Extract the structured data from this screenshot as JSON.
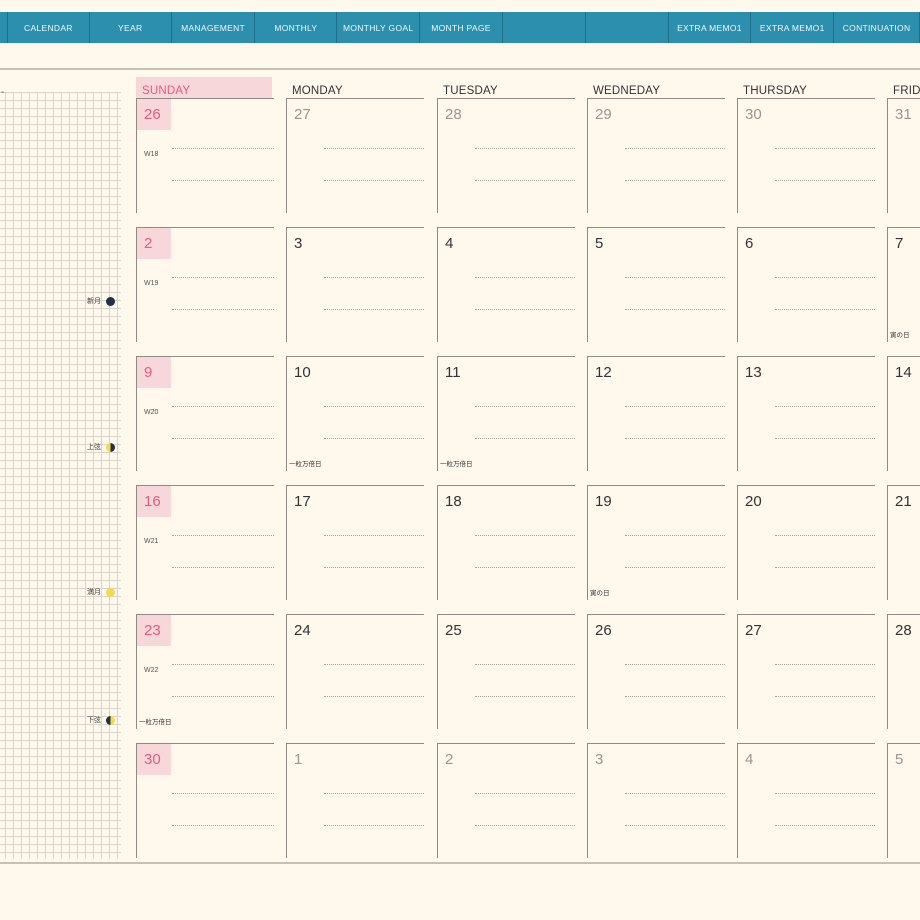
{
  "nav": [
    {
      "label": "",
      "w": 8
    },
    {
      "label": "CALENDAR",
      "w": 82
    },
    {
      "label": "YEAR",
      "w": 82
    },
    {
      "label": "MANAGEMENT",
      "w": 84
    },
    {
      "label": "MONTHLY",
      "w": 82
    },
    {
      "label": "MONTHLY GOAL",
      "w": 83
    },
    {
      "label": "MONTH PAGE",
      "w": 83
    },
    {
      "label": "",
      "w": 83
    },
    {
      "label": "",
      "w": 83
    },
    {
      "label": "EXTRA MEMO1",
      "w": 83
    },
    {
      "label": "EXTRA MEMO1",
      "w": 83
    },
    {
      "label": "CONTINUATION",
      "w": 86
    }
  ],
  "weekdays": [
    "SUNDAY",
    "MONDAY",
    "TUESDAY",
    "WEDNEDAY",
    "THURSDAY",
    "FRIDA"
  ],
  "weeks": [
    {
      "days": [
        "26",
        "27",
        "28",
        "29",
        "30",
        "31"
      ],
      "week": "W18",
      "other": [
        0,
        1,
        2,
        3,
        4,
        5
      ],
      "notes": [
        "",
        "",
        "",
        "",
        "",
        ""
      ]
    },
    {
      "days": [
        "2",
        "3",
        "4",
        "5",
        "6",
        "7"
      ],
      "week": "W19",
      "other": [],
      "notes": [
        "",
        "",
        "",
        "",
        "",
        "寅の日"
      ]
    },
    {
      "days": [
        "9",
        "10",
        "11",
        "12",
        "13",
        "14"
      ],
      "week": "W20",
      "other": [],
      "notes": [
        "",
        "一粒万倍日",
        "一粒万倍日",
        "",
        "",
        ""
      ]
    },
    {
      "days": [
        "16",
        "17",
        "18",
        "19",
        "20",
        "21"
      ],
      "week": "W21",
      "other": [],
      "notes": [
        "",
        "",
        "",
        "寅の日",
        "",
        ""
      ]
    },
    {
      "days": [
        "23",
        "24",
        "25",
        "26",
        "27",
        "28"
      ],
      "week": "W22",
      "other": [],
      "notes": [
        "一粒万倍日",
        "",
        "",
        "",
        "",
        ""
      ]
    },
    {
      "days": [
        "30",
        "1",
        "2",
        "3",
        "4",
        "5"
      ],
      "week": "",
      "other": [
        1,
        2,
        3,
        4,
        5
      ],
      "notes": [
        "",
        "",
        "",
        "",
        "",
        ""
      ]
    }
  ],
  "moons": [
    {
      "label": "新月",
      "phase": "new"
    },
    {
      "label": "上弦",
      "phase": "first"
    },
    {
      "label": "満月",
      "phase": "full"
    },
    {
      "label": "下弦",
      "phase": "last"
    }
  ],
  "grid_dash": "-",
  "colors": {
    "accent": "#2b8fad",
    "sunday": "#e35c7e",
    "sunday_bg": "#f8d7da",
    "paper": "#fff8ec"
  }
}
